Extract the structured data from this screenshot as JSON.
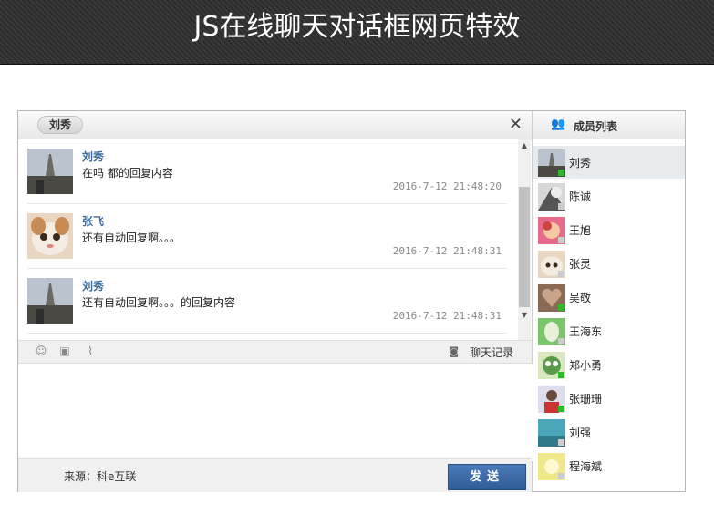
{
  "page": {
    "title": "JS在线聊天对话框网页特效"
  },
  "chat": {
    "current_user": "刘秀",
    "close_symbol": "✕",
    "messages": [
      {
        "name": "刘秀",
        "text": "在吗 都的回复内容",
        "time": "2016-7-12 21:48:20",
        "avatar": "tower-photo"
      },
      {
        "name": "张飞",
        "text": "还有自动回复啊。。。",
        "time": "2016-7-12 21:48:31",
        "avatar": "cat-photo"
      },
      {
        "name": "刘秀",
        "text": "还有自动回复啊。。。的回复内容",
        "time": "2016-7-12 21:48:31",
        "avatar": "tower-photo"
      }
    ],
    "toolbar": {
      "history_label": "聊天记录"
    },
    "input_value": "",
    "footer": {
      "source_label": "来源：科e互联",
      "send_label": "发送"
    }
  },
  "members": {
    "title": "成员列表",
    "items": [
      {
        "name": "刘秀",
        "online": true,
        "selected": true
      },
      {
        "name": "陈诚",
        "online": false
      },
      {
        "name": "王旭",
        "online": false
      },
      {
        "name": "张灵",
        "online": false
      },
      {
        "name": "吴敬",
        "online": true
      },
      {
        "name": "王海东",
        "online": false
      },
      {
        "name": "郑小勇",
        "online": true
      },
      {
        "name": "张珊珊",
        "online": true
      },
      {
        "name": "刘强",
        "online": false
      },
      {
        "name": "程海斌",
        "online": false
      }
    ]
  },
  "colors": {
    "accent": "#2e5c98",
    "online": "#2eb82e",
    "name_link": "#3a6a9a"
  }
}
